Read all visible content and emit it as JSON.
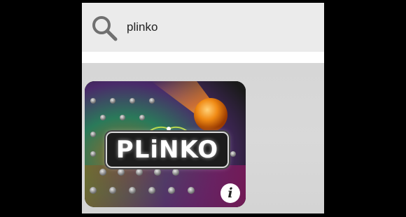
{
  "search": {
    "value": "plinko",
    "icon": "search-icon"
  },
  "results": [
    {
      "logo_text": "PLiNKO",
      "info_label": "i",
      "info_icon": "info-icon"
    }
  ],
  "colors": {
    "search_bar_bg": "#ebebeb",
    "content_bg": "#d6d6d6",
    "frame_bg": "#000000",
    "icon_gray": "#707070"
  }
}
